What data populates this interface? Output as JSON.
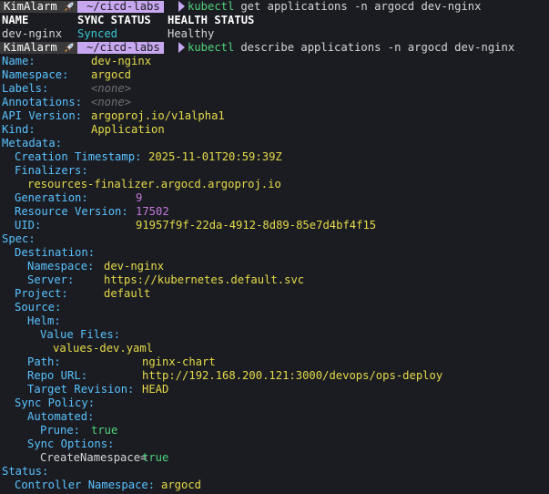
{
  "prompt": {
    "user": "KimAlarm",
    "dir": "~/cicd-labs"
  },
  "commands": [
    {
      "cmd": "kubectl",
      "args": " get applications -n argocd dev-nginx"
    },
    {
      "cmd": "kubectl",
      "args": " describe applications -n argocd dev-nginx"
    }
  ],
  "table": {
    "headers": [
      "NAME",
      "SYNC STATUS",
      "HEALTH STATUS"
    ],
    "row": [
      "dev-nginx",
      "Synced",
      "Healthy"
    ]
  },
  "describe": {
    "name_label": "Name:",
    "name": "dev-nginx",
    "namespace_label": "Namespace:",
    "namespace": "argocd",
    "labels_label": "Labels:",
    "labels": "<none>",
    "annotations_label": "Annotations:",
    "annotations": "<none>",
    "api_version_label": "API Version:",
    "api_version": "argoproj.io/v1alpha1",
    "kind_label": "Kind:",
    "kind": "Application",
    "metadata_label": "Metadata:",
    "creation_label": "Creation Timestamp:",
    "creation": "2025-11-01T20:59:39Z",
    "finalizers_label": "Finalizers:",
    "finalizer": "resources-finalizer.argocd.argoproj.io",
    "generation_label": "Generation:",
    "generation": "9",
    "resource_version_label": "Resource Version:",
    "resource_version": "17502",
    "uid_label": "UID:",
    "uid": "91957f9f-22da-4912-8d89-85e7d4bf4f15",
    "spec_label": "Spec:",
    "destination_label": "Destination:",
    "dest_namespace_label": "Namespace:",
    "dest_namespace": "dev-nginx",
    "dest_server_label": "Server:",
    "dest_server": "https://kubernetes.default.svc",
    "project_label": "Project:",
    "project": "default",
    "source_label": "Source:",
    "helm_label": "Helm:",
    "value_files_label": "Value Files:",
    "value_file": "values-dev.yaml",
    "path_label": "Path:",
    "path": "nginx-chart",
    "repo_url_label": "Repo URL:",
    "repo_url": "http://192.168.200.121:3000/devops/ops-deploy",
    "target_revision_label": "Target Revision:",
    "target_revision": "HEAD",
    "sync_policy_label": "Sync Policy:",
    "automated_label": "Automated:",
    "prune_label": "Prune:",
    "prune": "true",
    "sync_options_label": "Sync Options:",
    "sync_option_key": "CreateNamespace=",
    "sync_option_val": "true",
    "status_label": "Status:",
    "controller_ns_label": "Controller Namespace:",
    "controller_ns": "argocd"
  },
  "colors": {
    "background": "#1b1c22",
    "key": "#59c2ff",
    "value": "#e6db4a",
    "command": "#4fd37a",
    "prompt_dir_bg": "#c7a8f0",
    "number": "#c678dd"
  },
  "icons": {
    "prompt_icon": "rocket-icon"
  }
}
